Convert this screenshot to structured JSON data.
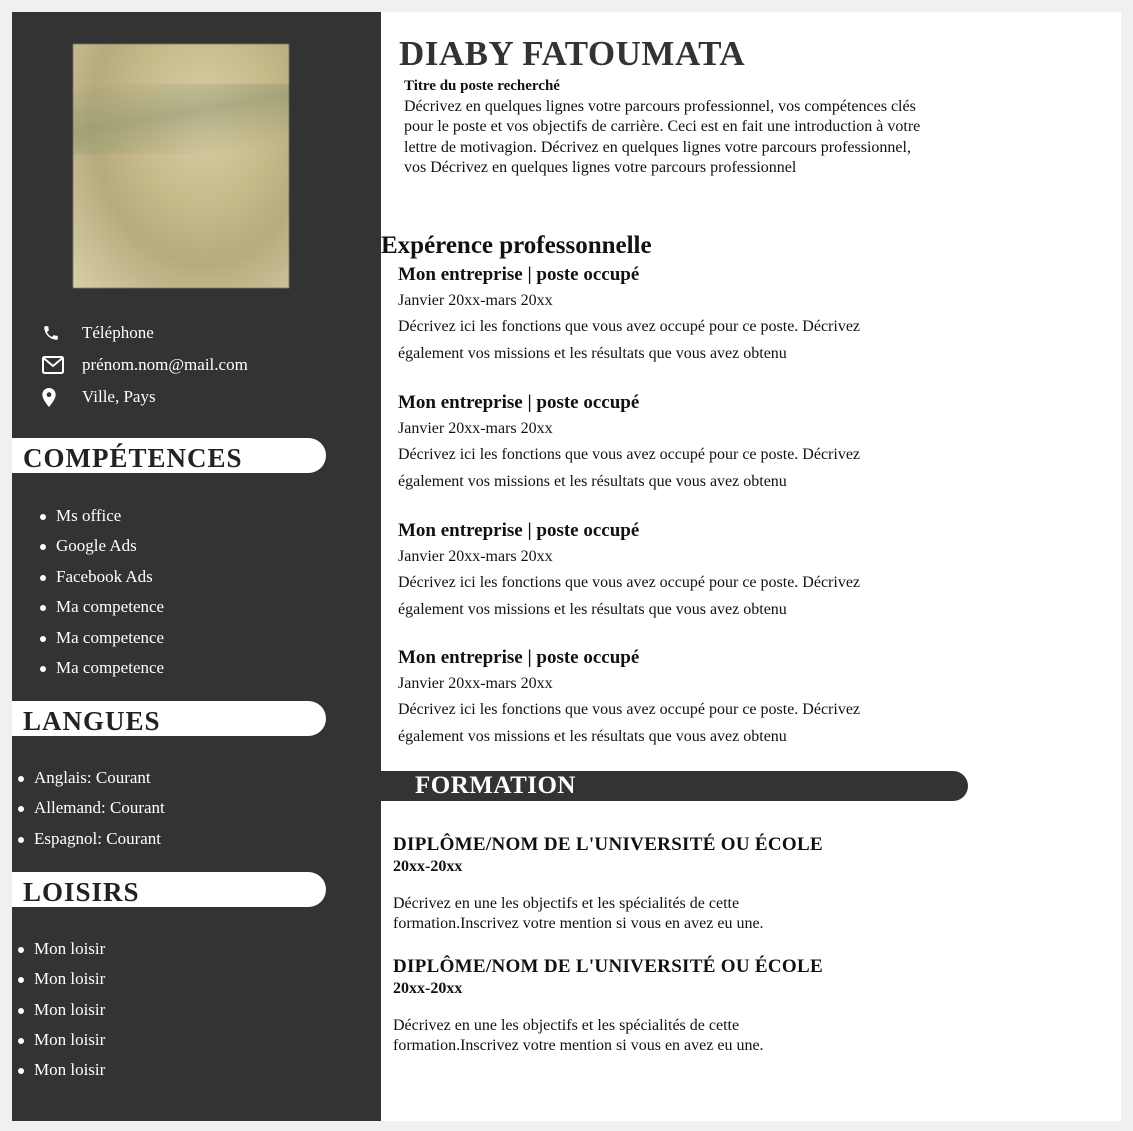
{
  "contact": {
    "phone": "Téléphone",
    "email": "prénom.nom@mail.com",
    "location": "Ville, Pays"
  },
  "sidebar": {
    "skills_title": "COMPÉTENCES",
    "skills": [
      "Ms office",
      "Google Ads",
      "Facebook Ads",
      "Ma competence",
      "Ma competence",
      "Ma competence"
    ],
    "languages_title": "LANGUES",
    "languages": [
      "Anglais: Courant",
      "Allemand: Courant",
      "Espagnol: Courant"
    ],
    "hobbies_title": "LOISIRS",
    "hobbies": [
      "Mon loisir",
      "Mon loisir",
      "Mon loisir",
      "Mon loisir",
      "Mon loisir"
    ]
  },
  "header": {
    "name": "DIABY FATOUMATA",
    "job_title": "Titre du poste recherché",
    "intro": "Décrivez en quelques lignes votre parcours professionnel, vos compétences clés pour le poste et vos objectifs de carrière. Ceci est en fait une introduction à votre lettre de motivagion. Décrivez en quelques lignes votre parcours professionnel, vos Décrivez en quelques lignes votre parcours professionnel"
  },
  "experience": {
    "title": "Expérence professonnelle",
    "items": [
      {
        "heading": "Mon entreprise | poste occupé",
        "dates": "Janvier 20xx-mars 20xx",
        "description": "Décrivez ici les fonctions que vous avez occupé pour ce poste. Décrivez également vos missions et les résultats que vous avez obtenu"
      },
      {
        "heading": "Mon entreprise | poste occupé",
        "dates": "Janvier 20xx-mars 20xx",
        "description": "Décrivez ici les fonctions que vous avez occupé pour ce poste. Décrivez également vos missions et les résultats que vous avez obtenu"
      },
      {
        "heading": "Mon entreprise | poste occupé",
        "dates": "Janvier 20xx-mars 20xx",
        "description": "Décrivez ici les fonctions que vous avez occupé pour ce poste. Décrivez également vos missions et les résultats que vous avez obtenu"
      },
      {
        "heading": "Mon entreprise | poste occupé",
        "dates": "Janvier 20xx-mars 20xx",
        "description": "Décrivez ici les fonctions que vous avez occupé pour ce poste. Décrivez également vos missions et les résultats que vous avez obtenu"
      }
    ]
  },
  "education": {
    "title": "FORMATION",
    "items": [
      {
        "degree": "DIPLÔME/NOM DE L'UNIVERSITÉ OU ÉCOLE",
        "years": "20xx-20xx",
        "description": "Décrivez en une les objectifs et les spécialités de cette formation.Inscrivez votre mention si vous en avez eu une."
      },
      {
        "degree": "DIPLÔME/NOM DE L'UNIVERSITÉ OU ÉCOLE",
        "years": "20xx-20xx",
        "description": "Décrivez en une les objectifs et les spécialités de cette formation.Inscrivez votre mention si vous en avez eu une."
      }
    ]
  },
  "colors": {
    "sidebar_bg": "#333333",
    "page_bg": "#ffffff",
    "outer_bg": "#eef0f2"
  }
}
